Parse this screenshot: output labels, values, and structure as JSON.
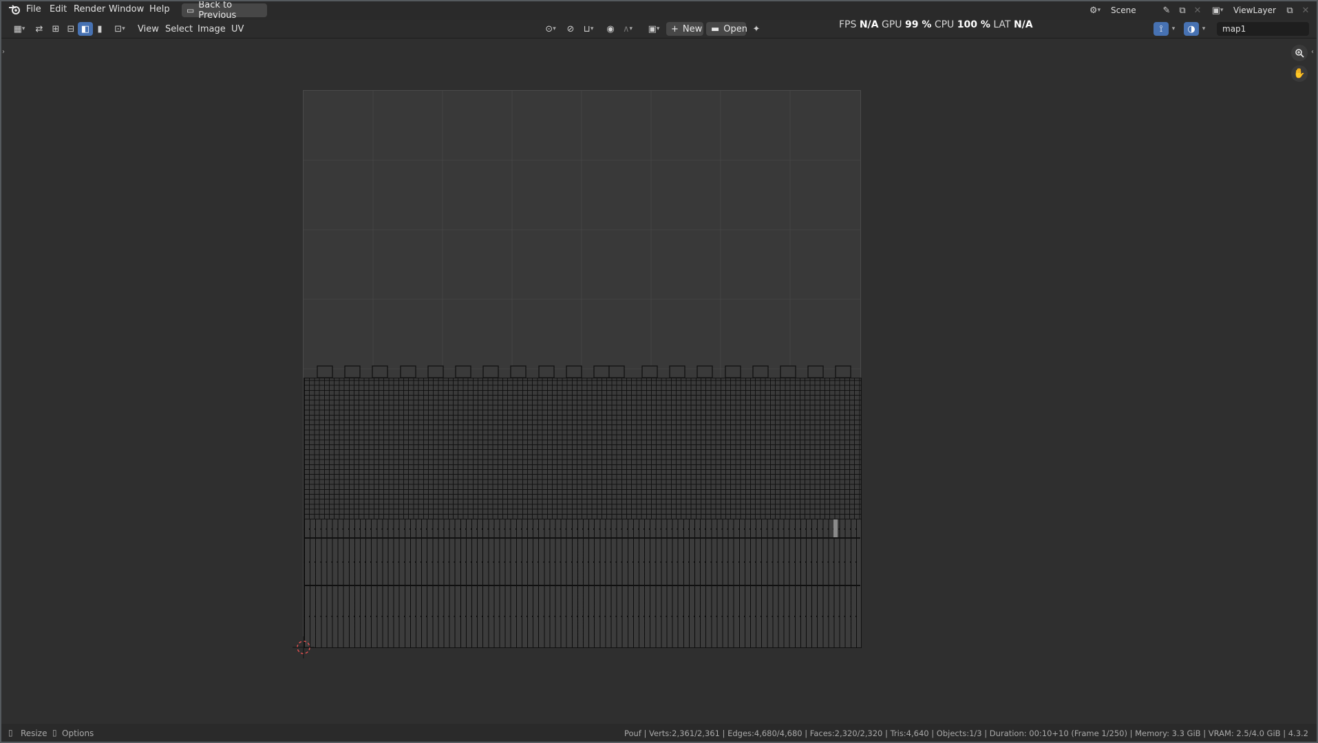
{
  "menubar": {
    "items": [
      "File",
      "Edit",
      "Render",
      "Window",
      "Help"
    ],
    "back_button": "Back to Previous",
    "scene": "Scene",
    "view_layer": "ViewLayer"
  },
  "editor_header": {
    "menus": [
      "View",
      "Select",
      "Image",
      "UV"
    ],
    "new_label": "New",
    "open_label": "Open",
    "uv_map": "map1"
  },
  "stats_overlay": {
    "fps_label": "FPS",
    "fps_value": "N/A",
    "gpu_label": "GPU",
    "gpu_value": "99 %",
    "cpu_label": "CPU",
    "cpu_value": "100 %",
    "lat_label": "LAT",
    "lat_value": "N/A"
  },
  "statusbar": {
    "resize_label": "Resize",
    "options_label": "Options",
    "info": "Pouf | Verts:2,361/2,361 | Edges:4,680/4,680 | Faces:2,320/2,320 | Tris:4,640 | Objects:1/3 | Duration: 00:10+10 (Frame 1/250) | Memory: 3.3 GiB | VRAM: 2.5/4.0 GiB | 4.3.2"
  },
  "icons": {
    "app": "blender-logo-icon",
    "zoom": "zoom-icon",
    "pan": "hand-icon",
    "cursor": "2d-cursor-icon"
  },
  "colors": {
    "background": "#232323",
    "panel": "#2c2c2c",
    "viewport": "#2f2f2f",
    "accent": "#4772b3",
    "cursor": "#e05050"
  }
}
